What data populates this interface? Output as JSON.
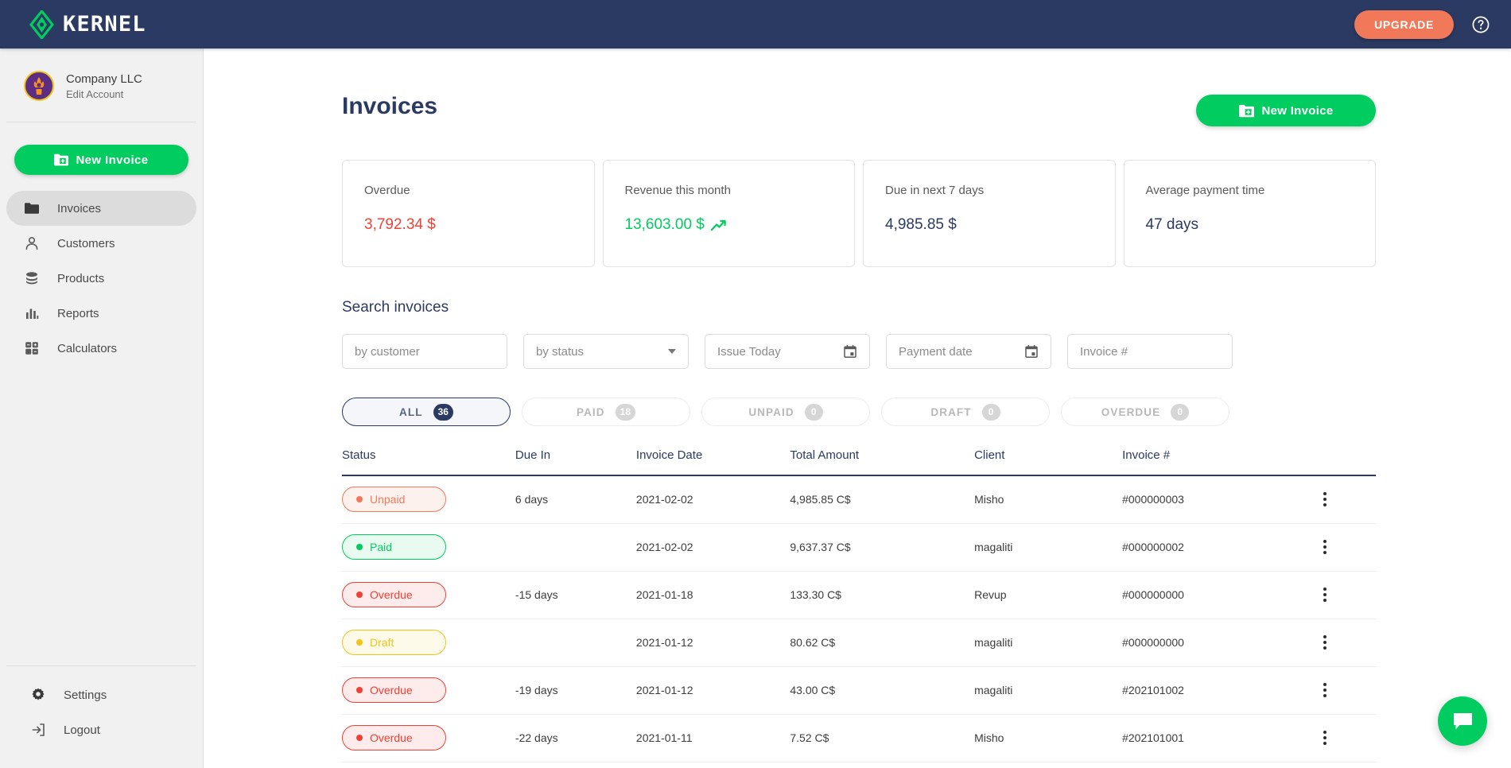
{
  "topbar": {
    "brand_name": "KERNEL",
    "upgrade_label": "UPGRADE",
    "help_icon": "question-circle-icon",
    "bg_color": "#2b3a63",
    "upgrade_color": "#f1795a"
  },
  "sidebar": {
    "account": {
      "name": "Company LLC",
      "edit_label": "Edit Account",
      "avatar_icon": "user-avatar-flame"
    },
    "new_invoice_label": "New Invoice",
    "items": [
      {
        "label": "Invoices",
        "icon": "folder-icon",
        "active": true
      },
      {
        "label": "Customers",
        "icon": "user-icon",
        "active": false
      },
      {
        "label": "Products",
        "icon": "database-icon",
        "active": false
      },
      {
        "label": "Reports",
        "icon": "bar-chart-icon",
        "active": false
      },
      {
        "label": "Calculators",
        "icon": "calculator-icon",
        "active": false
      }
    ],
    "bottom_items": [
      {
        "label": "Settings",
        "icon": "gear-icon"
      },
      {
        "label": "Logout",
        "icon": "logout-icon"
      }
    ]
  },
  "main": {
    "page_title": "Invoices",
    "new_invoice_label": "New Invoice",
    "cards": [
      {
        "label": "Overdue",
        "value": "3,792.34 $",
        "color": "red",
        "trend": false
      },
      {
        "label": "Revenue this month",
        "value": "13,603.00 $",
        "color": "green",
        "trend": true
      },
      {
        "label": "Due in next 7 days",
        "value": "4,985.85 $",
        "color": "default",
        "trend": false
      },
      {
        "label": "Average payment time",
        "value": "47 days",
        "color": "default",
        "trend": false
      }
    ],
    "search": {
      "title": "Search invoices",
      "customer_placeholder": "by customer",
      "status_placeholder": "by status",
      "issue_placeholder": "Issue Today",
      "payment_placeholder": "Payment date",
      "invoice_placeholder": "Invoice #"
    },
    "tabs": [
      {
        "label": "ALL",
        "count": "36",
        "active": true
      },
      {
        "label": "PAID",
        "count": "18",
        "active": false
      },
      {
        "label": "UNPAID",
        "count": "0",
        "active": false
      },
      {
        "label": "DRAFT",
        "count": "0",
        "active": false
      },
      {
        "label": "OVERDUE",
        "count": "0",
        "active": false
      }
    ],
    "table": {
      "columns": [
        "Status",
        "Due In",
        "Invoice Date",
        "Total Amount",
        "Client",
        "Invoice #"
      ],
      "rows": [
        {
          "status": "Unpaid",
          "status_class": "unpaid",
          "due_in": "6 days",
          "invoice_date": "2021-02-02",
          "total_amount": "4,985.85 C$",
          "client": "Misho",
          "invoice_number": "#000000003"
        },
        {
          "status": "Paid",
          "status_class": "paid",
          "due_in": "",
          "invoice_date": "2021-02-02",
          "total_amount": "9,637.37 C$",
          "client": "magaliti",
          "invoice_number": "#000000002"
        },
        {
          "status": "Overdue",
          "status_class": "overdue",
          "due_in": "-15 days",
          "invoice_date": "2021-01-18",
          "total_amount": "133.30 C$",
          "client": "Revup",
          "invoice_number": "#000000000"
        },
        {
          "status": "Draft",
          "status_class": "draft",
          "due_in": "",
          "invoice_date": "2021-01-12",
          "total_amount": "80.62 C$",
          "client": "magaliti",
          "invoice_number": "#000000000"
        },
        {
          "status": "Overdue",
          "status_class": "overdue",
          "due_in": "-19 days",
          "invoice_date": "2021-01-12",
          "total_amount": "43.00 C$",
          "client": "magaliti",
          "invoice_number": "#202101002"
        },
        {
          "status": "Overdue",
          "status_class": "overdue",
          "due_in": "-22 days",
          "invoice_date": "2021-01-11",
          "total_amount": "7.52 C$",
          "client": "Misho",
          "invoice_number": "#202101001"
        }
      ]
    }
  },
  "chat": {
    "icon": "chat-bubble-icon",
    "color": "#00cc5f"
  }
}
